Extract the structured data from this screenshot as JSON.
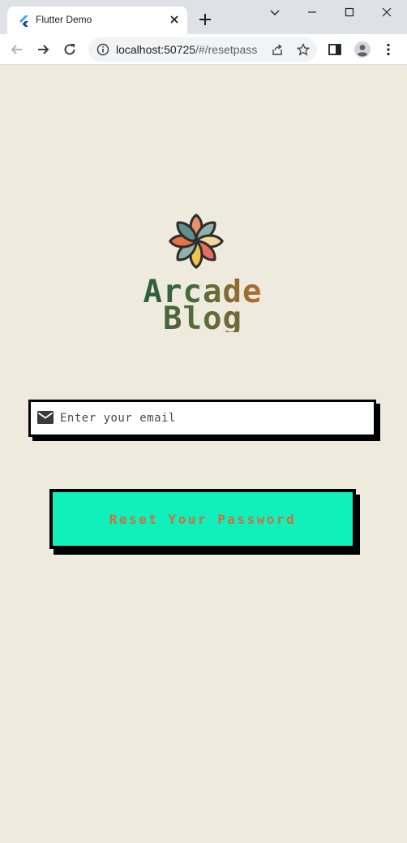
{
  "browser": {
    "tab_title": "Flutter Demo",
    "url_host": "localhost:50725",
    "url_path": "/#/resetpass",
    "icons": [
      "flutter-icon",
      "close-icon",
      "plus-icon",
      "chevron-down-icon",
      "minimize-icon",
      "maximize-icon",
      "close-window-icon",
      "back-arrow-icon",
      "forward-arrow-icon",
      "reload-icon",
      "info-icon",
      "share-icon",
      "star-icon",
      "side-panel-icon",
      "profile-icon",
      "more-vert-icon"
    ]
  },
  "logo": {
    "line1": "Arcade",
    "line2": "Blog"
  },
  "email": {
    "placeholder": "Enter your email",
    "icon": "mail-icon"
  },
  "reset_button": {
    "label": "Reset Your Password"
  },
  "colors": {
    "page_bg": "#eeebde",
    "button_bg": "#0ff0bd",
    "button_text": "#d0703c",
    "border": "#000000"
  }
}
